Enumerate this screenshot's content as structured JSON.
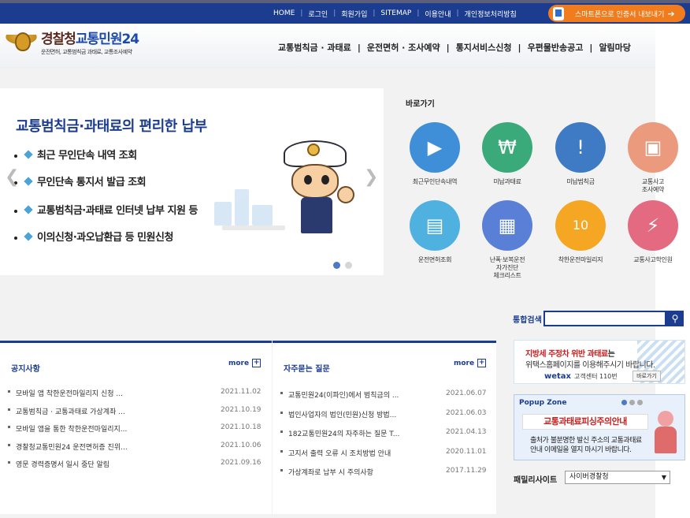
{
  "topnav": {
    "links": [
      "HOME",
      "로그인",
      "회원가입",
      "SITEMAP",
      "이용안내",
      "개인정보처리방침"
    ],
    "smart_button": "스마트폰으로 인증서 내보내기"
  },
  "logo": {
    "title_main": "경찰청",
    "title_accent": "교통민원24",
    "subtitle": "운전면허, 교통범칙금 과태료, 교통조사예약"
  },
  "mainnav": [
    "교통범칙금 · 과태료",
    "운전면허 · 조사예약",
    "통지서비스신청",
    "우편물반송공고",
    "알림마당"
  ],
  "banner": {
    "headline": "교통범칙금·과태료의 편리한 납부",
    "bullets": [
      "최근 무인단속 내역 조회",
      "무인단속 통지서 발급 조회",
      "교통범칙금·과태료 인터넷 납부 지원 등",
      "이의신청·과오납환급 등 민원신청"
    ],
    "prev_glyph": "❮",
    "next_glyph": "❯"
  },
  "quick": {
    "title": "바로가기",
    "items": [
      {
        "label": "최근무인단속내역",
        "icon": "camera-icon",
        "color": "#3f8fd8",
        "glyph": "▶"
      },
      {
        "label": "미납과태료",
        "icon": "money-icon",
        "color": "#3aaa7a",
        "glyph": "₩"
      },
      {
        "label": "미납범칙금",
        "icon": "warning-sign-icon",
        "color": "#3f7bc4",
        "glyph": "!"
      },
      {
        "label": "교통사고\n조사예약",
        "icon": "monitor-icon",
        "color": "#ec9a7e",
        "glyph": "▣"
      },
      {
        "label": "운전면허조회",
        "icon": "license-card-icon",
        "color": "#4fb1e0",
        "glyph": "▤"
      },
      {
        "label": "난폭·보복운전\n자가진단\n체크리스트",
        "icon": "checklist-grid-icon",
        "color": "#5a7fd6",
        "glyph": "▦"
      },
      {
        "label": "착한운전마일리지",
        "icon": "mileage-card-icon",
        "color": "#f5a623",
        "glyph": "10"
      },
      {
        "label": "교통사고학인원",
        "icon": "car-crash-icon",
        "color": "#e36a80",
        "glyph": "⚡"
      }
    ]
  },
  "search": {
    "label": "통합검색",
    "button_glyph": "⚲"
  },
  "notice": {
    "title": "공지사항",
    "more": "more",
    "items": [
      {
        "title": "모바일 앱 착한운전마일리지 신청 ...",
        "date": "2021.11.02"
      },
      {
        "title": "교통범칙금 · 교통과태료 가상계좌 ...",
        "date": "2021.10.19"
      },
      {
        "title": "모바일 앱을 통한 착한운전마일리지...",
        "date": "2021.10.18"
      },
      {
        "title": "경찰청교통민원24 운전면허증 진위...",
        "date": "2021.10.06"
      },
      {
        "title": "영문 경력증명서 일시 중단 알림",
        "date": "2021.09.16"
      }
    ]
  },
  "faq": {
    "title": "자주묻는 질문",
    "more": "more",
    "items": [
      {
        "title": "교통민원24(이파인)에서 범칙금의 ...",
        "date": "2021.06.07"
      },
      {
        "title": "법인사업자의 법인(민원)신청 방법...",
        "date": "2021.06.03"
      },
      {
        "title": "182교통민원24의 자주하는 질문 T...",
        "date": "2021.04.13"
      },
      {
        "title": "고지서 출력 오류 시 조치방법 안내",
        "date": "2020.11.01"
      },
      {
        "title": "가상계좌로 납부 시 주의사항",
        "date": "2017.11.29"
      }
    ]
  },
  "ad": {
    "line1_red": "지방세 주정차 위반 과태료",
    "line1_rest": "는",
    "line2": "위택스홈페이지를 이용해주시기 바랍니다.",
    "wetax": "wetax",
    "center": "고객센터 110번",
    "shortcut": "바로가기"
  },
  "popup": {
    "zone_label": "Popup Zone",
    "warning": "교통과태료피싱주의안내",
    "line1": "출처가 불분명한 발신 주소의 교통과태료",
    "line2": "안내 이메일을 열지 마시기 바랍니다."
  },
  "family": {
    "label": "패밀리사이트",
    "selected": "사이버경찰청",
    "caret": "▼"
  }
}
